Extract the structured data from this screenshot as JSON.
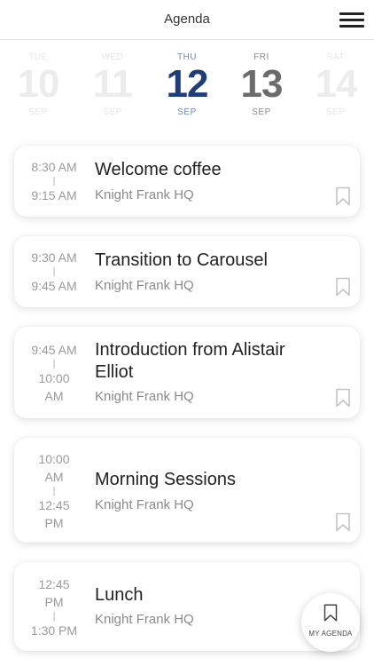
{
  "header": {
    "title": "Agenda"
  },
  "dates": [
    {
      "dow": "TUE",
      "day": "10",
      "month": "SEP",
      "state": "faded"
    },
    {
      "dow": "WED",
      "day": "11",
      "month": "SEP",
      "state": "faded"
    },
    {
      "dow": "THU",
      "day": "12",
      "month": "SEP",
      "state": "active"
    },
    {
      "dow": "FRI",
      "day": "13",
      "month": "SEP",
      "state": "normal"
    },
    {
      "dow": "SAT",
      "day": "14",
      "month": "SEP",
      "state": "faded"
    }
  ],
  "events": [
    {
      "start": "8:30 AM",
      "end": "9:15 AM",
      "title": "Welcome coffee",
      "location": "Knight Frank HQ",
      "bookmarked": false
    },
    {
      "start": "9:30 AM",
      "end": "9:45 AM",
      "title": "Transition to Carousel",
      "location": "Knight Frank HQ",
      "bookmarked": false
    },
    {
      "start": "9:45 AM",
      "end": "10:00 AM",
      "title": "Introduction from Alistair Elliot",
      "location": "Knight Frank HQ",
      "bookmarked": false
    },
    {
      "start": "10:00 AM",
      "end": "12:45 PM",
      "title": "Morning Sessions",
      "location": "Knight Frank HQ",
      "bookmarked": false
    },
    {
      "start": "12:45 PM",
      "end": "1:30 PM",
      "title": "Lunch",
      "location": "Knight Frank HQ",
      "bookmarked": false
    }
  ],
  "time_separator": "|",
  "fab": {
    "label": "MY AGENDA",
    "icon": "bookmark-icon"
  },
  "colors": {
    "active_day": "#1f3d7a",
    "active_label": "#6e88b4"
  }
}
